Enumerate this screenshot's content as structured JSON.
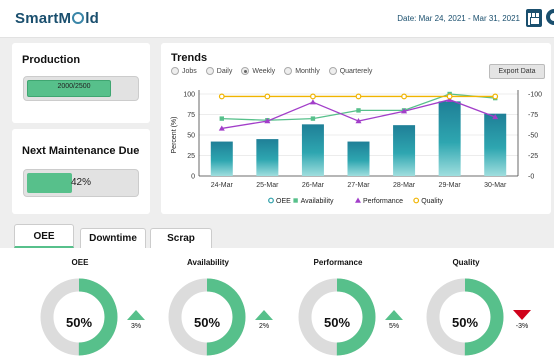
{
  "header": {
    "logo_text": "SmartMold",
    "logo_before": "SmartM",
    "logo_after": "ld",
    "date_range": "Date: Mar 24, 2021 - Mar 31, 2021",
    "icons": [
      "calendar-icon",
      "gear-icon"
    ]
  },
  "production": {
    "title": "Production",
    "value_text": "2000/2500",
    "progress": 0.8,
    "color": "#57c08b"
  },
  "maintenance": {
    "title": "Next Maintenance Due",
    "value_text": "42%",
    "progress": 0.42
  },
  "trends": {
    "title": "Trends",
    "ranges": [
      {
        "label": "Jobs",
        "selected": false
      },
      {
        "label": "Daily",
        "selected": false
      },
      {
        "label": "Weekly",
        "selected": true
      },
      {
        "label": "Monthly",
        "selected": false
      },
      {
        "label": "Quarterely",
        "selected": false
      }
    ],
    "export_label": "Export Data"
  },
  "chart_data": {
    "type": "bar",
    "ylabel": "Percent (%)",
    "categories": [
      "24-Mar",
      "25-Mar",
      "26-Mar",
      "27-Mar",
      "28-Mar",
      "29-Mar",
      "30-Mar"
    ],
    "ylim": [
      0,
      100
    ],
    "yticks": [
      0,
      25,
      50,
      75,
      100
    ],
    "grid": true,
    "legend_position": "bottom",
    "series": [
      {
        "name": "OEE",
        "type": "bar",
        "color": "#2b9ea8",
        "values": [
          42,
          45,
          63,
          42,
          62,
          91,
          76
        ]
      },
      {
        "name": "Availability",
        "type": "line",
        "color": "#57c08b",
        "values": [
          70,
          68,
          70,
          80,
          80,
          100,
          95
        ]
      },
      {
        "name": "Performance",
        "type": "line",
        "color": "#a23ec9",
        "values": [
          58,
          67,
          90,
          67,
          79,
          93,
          72
        ]
      },
      {
        "name": "Quality",
        "type": "line",
        "color": "#f0b400",
        "values": [
          97,
          97,
          97,
          97,
          97,
          97,
          97
        ]
      }
    ]
  },
  "tabs": [
    {
      "label": "OEE",
      "active": true
    },
    {
      "label": "Downtime",
      "active": false
    },
    {
      "label": "Scrap",
      "active": false
    }
  ],
  "metrics": [
    {
      "title": "OEE",
      "value": "50%",
      "fraction": 0.5,
      "change": "3%",
      "direction": "up"
    },
    {
      "title": "Availability",
      "value": "50%",
      "fraction": 0.5,
      "change": "2%",
      "direction": "up"
    },
    {
      "title": "Performance",
      "value": "50%",
      "fraction": 0.5,
      "change": "5%",
      "direction": "up"
    },
    {
      "title": "Quality",
      "value": "50%",
      "fraction": 0.5,
      "change": "-3%",
      "direction": "down"
    }
  ],
  "colors": {
    "accent": "#57c08b",
    "track": "#dcdcdc",
    "negative": "#d0021b"
  }
}
